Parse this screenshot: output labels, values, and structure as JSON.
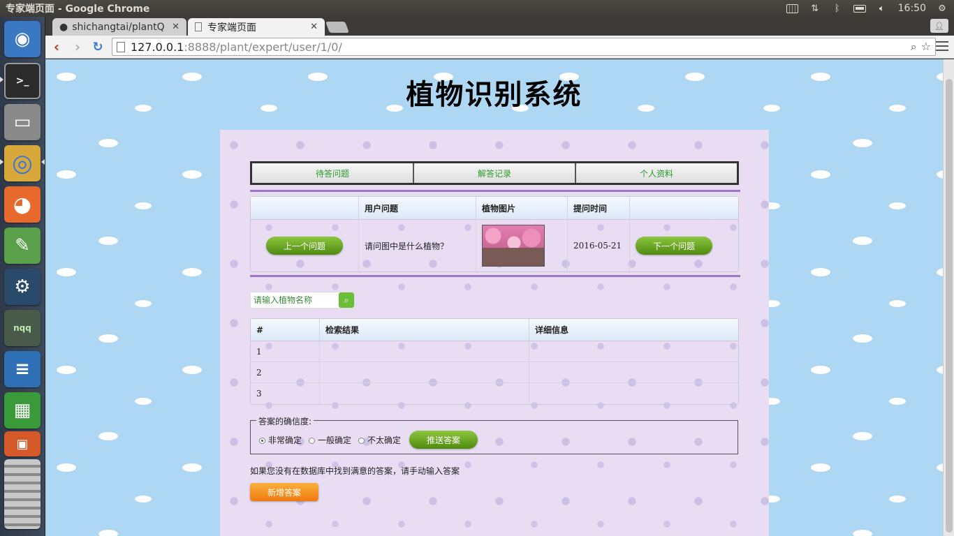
{
  "os": {
    "window_title": "专家端页面 - Google Chrome",
    "clock": "16:50"
  },
  "launcher": {
    "items": [
      {
        "name": "ubuntu-dash",
        "glyph": "◉",
        "bg": "#3b78c3"
      },
      {
        "name": "terminal",
        "glyph": ">_",
        "bg": "#2b2b2b"
      },
      {
        "name": "files",
        "glyph": "▭",
        "bg": "#8a8a8a"
      },
      {
        "name": "chrome",
        "glyph": "◎",
        "bg": "#e8e8e8"
      },
      {
        "name": "firefox",
        "glyph": "◕",
        "bg": "#e8692c"
      },
      {
        "name": "editor",
        "glyph": "✎",
        "bg": "#5aa04a"
      },
      {
        "name": "mysql-workbench",
        "glyph": "⚙",
        "bg": "#2a4a6a"
      },
      {
        "name": "nqq",
        "glyph": "nqq",
        "bg": "#4a5a4a"
      },
      {
        "name": "writer",
        "glyph": "≡",
        "bg": "#2f6fb5"
      },
      {
        "name": "calc",
        "glyph": "▦",
        "bg": "#3a9a3a"
      },
      {
        "name": "impress",
        "glyph": "▣",
        "bg": "#d55a2a"
      }
    ]
  },
  "browser": {
    "tabs": [
      {
        "label": "shichangtai/plantQ"
      },
      {
        "label": "专家端页面"
      }
    ],
    "url_host": "127.0.0.1",
    "url_path": ":8888/plant/expert/user/1/0/"
  },
  "page": {
    "title": "植物识别系统",
    "nav": [
      "待答问题",
      "解答记录",
      "个人资料"
    ],
    "question_table": {
      "headers": [
        "",
        "用户问题",
        "植物图片",
        "提问时间",
        ""
      ],
      "prev_label": "上一个问题",
      "question": "请问图中是什么植物？",
      "date": "2016-05-21",
      "next_label": "下一个问题"
    },
    "search": {
      "placeholder": "请输入植物名称"
    },
    "results_table": {
      "headers": [
        "#",
        "检索结果",
        "详细信息"
      ],
      "rows": [
        {
          "num": "1",
          "result": "",
          "detail": ""
        },
        {
          "num": "2",
          "result": "",
          "detail": ""
        },
        {
          "num": "3",
          "result": "",
          "detail": ""
        }
      ]
    },
    "confidence": {
      "legend": "答案的确信度:",
      "options": [
        "非常确定",
        "一般确定",
        "不太确定"
      ],
      "selected": "非常确定",
      "submit_label": "推送答案"
    },
    "hint": "如果您没有在数据库中找到满意的答案，请手动输入答案",
    "add_answer_label": "新增答案"
  },
  "colors": {
    "accent_green": "#4f8a10",
    "nav_text": "#2a9a2a",
    "divider": "#9f79c4",
    "panel_bg": "#e8ddf3",
    "sky_bg": "#aed7f4",
    "orange": "#f07a12"
  }
}
